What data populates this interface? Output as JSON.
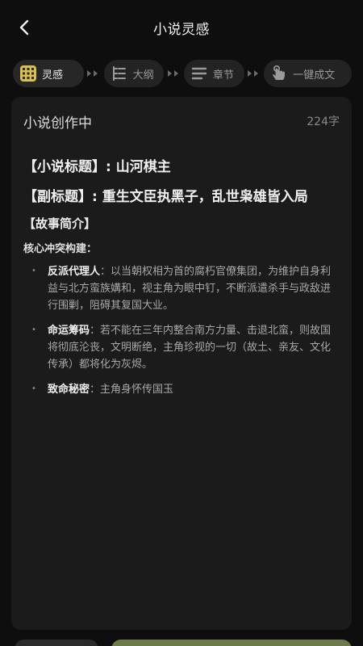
{
  "header": {
    "title": "小说灵感"
  },
  "steps": [
    {
      "label": "灵感",
      "icon": "grid-inspiration-icon",
      "active": true
    },
    {
      "label": "大纲",
      "icon": "outline-list-icon",
      "active": false
    },
    {
      "label": "章节",
      "icon": "chapter-lines-icon",
      "active": false
    },
    {
      "label": "一键成文",
      "icon": "tap-hand-icon",
      "active": false
    }
  ],
  "card": {
    "status": "小说创作中",
    "char_count": "224字",
    "title_line": "【小说标题】: 山河棋主",
    "subtitle_line": "【副标题】: 重生文臣执黑子，乱世枭雄皆入局",
    "section_head": "【故事简介】",
    "sub_head": "核心冲突构建：",
    "bullets": [
      {
        "key": "反派代理人",
        "text": "：以当朝权相为首的腐朽官僚集团，为维护自身利益与北方蛮族媾和，视主角为眼中钉，不断派遣杀手与政敌进行围剿，阻碍其复国大业。"
      },
      {
        "key": "命运筹码",
        "text": "：若不能在三年内整合南方力量、击退北蛮，则故国将彻底沦丧，文明断绝，主角珍视的一切（故土、亲友、文化传承）都将化为灰烬。"
      },
      {
        "key": "致命秘密",
        "text": "：主角身怀传国玉"
      }
    ]
  }
}
